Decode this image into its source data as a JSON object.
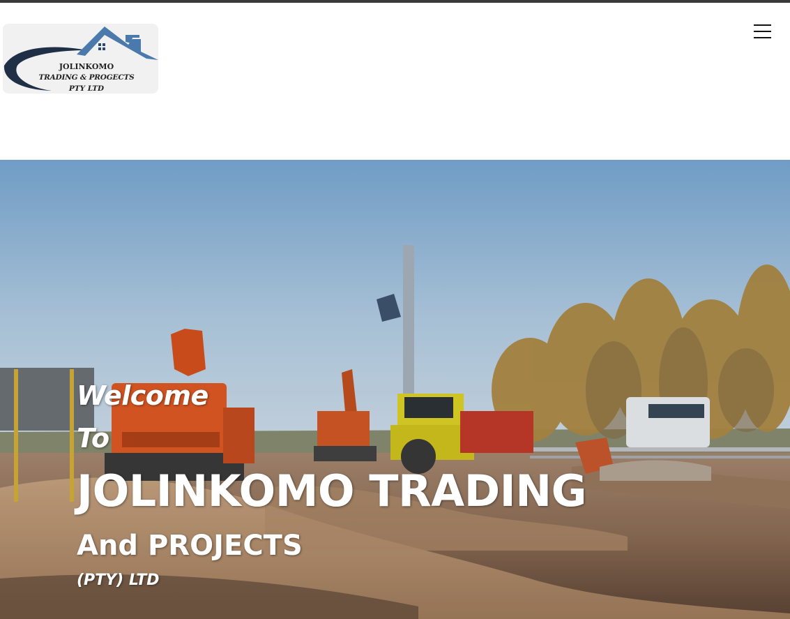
{
  "header": {
    "logo": {
      "line1": "JOLINKOMO",
      "line2": "TRADING & PROGECTS",
      "line3": "PTY LTD",
      "colors": {
        "roof": "#4a79ac",
        "swoosh": "#1f2f45",
        "background": "#f1f1f1"
      }
    },
    "menu_icon": "hamburger-menu-icon"
  },
  "hero": {
    "welcome": "Welcome",
    "to": "To",
    "title": "JOLINKOMO TRADING",
    "subtitle": "And PROJECTS",
    "tagline": "(PTY) LTD",
    "background": "construction site with excavators and a road-building roller under a blue sky"
  },
  "colors": {
    "topbar": "#3a3a3a",
    "hero_text": "#ffffff"
  }
}
